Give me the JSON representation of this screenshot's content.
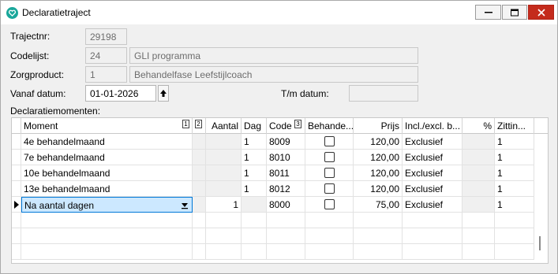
{
  "window": {
    "title": "Declaratietraject"
  },
  "form": {
    "trajectnr": {
      "label": "Trajectnr:",
      "value": "29198"
    },
    "codelijst": {
      "label": "Codelijst:",
      "code": "24",
      "name": "GLI programma"
    },
    "zorgproduct": {
      "label": "Zorgproduct:",
      "code": "1",
      "name": "Behandelfase Leefstijlcoach"
    },
    "vanaf": {
      "label": "Vanaf datum:",
      "value": "01-01-2026"
    },
    "tm": {
      "label": "T/m datum:",
      "value": ""
    },
    "section_label": "Declaratiemomenten:"
  },
  "grid": {
    "headers": {
      "moment": "Moment",
      "tag1": "1",
      "tag2": "2",
      "aantal": "Aantal",
      "dag": "Dag",
      "code": "Code",
      "tag3": "3",
      "behandel": "Behande...",
      "prijs": "Prijs",
      "incl": "Incl./excl. b...",
      "pct": "%",
      "zitting": "Zittin..."
    },
    "rows": [
      {
        "moment": "4e behandelmaand",
        "aantal": "",
        "dag": "1",
        "code": "8009",
        "checked": false,
        "prijs": "120,00",
        "incl": "Exclusief",
        "pct": "",
        "zitting": "1"
      },
      {
        "moment": "7e behandelmaand",
        "aantal": "",
        "dag": "1",
        "code": "8010",
        "checked": false,
        "prijs": "120,00",
        "incl": "Exclusief",
        "pct": "",
        "zitting": "1"
      },
      {
        "moment": "10e behandelmaand",
        "aantal": "",
        "dag": "1",
        "code": "8011",
        "checked": false,
        "prijs": "120,00",
        "incl": "Exclusief",
        "pct": "",
        "zitting": "1"
      },
      {
        "moment": "13e behandelmaand",
        "aantal": "",
        "dag": "1",
        "code": "8012",
        "checked": false,
        "prijs": "120,00",
        "incl": "Exclusief",
        "pct": "",
        "zitting": "1"
      },
      {
        "moment": "Na aantal dagen",
        "aantal": "1",
        "dag": "",
        "code": "8000",
        "checked": false,
        "prijs": "75,00",
        "incl": "Exclusief",
        "pct": "",
        "zitting": "1"
      }
    ]
  }
}
